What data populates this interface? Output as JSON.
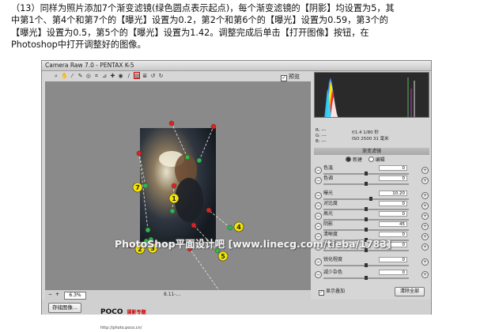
{
  "instructions": {
    "line1": "（13）同样为照片添加7个渐变滤镜(绿色圆点表示起点)，每个渐变滤镜的【阴影】均设置为5，其",
    "line2": "中第1个、第4个和第7个的【曝光】设置为0.2，第2个和第6个的【曝光】设置为0.59，第3个的",
    "line3": "【曝光】设置为0.5，第5个的【曝光】设置为1.42。调整完成后单击【打开图像】按钮，在",
    "line4": "Photoshop中打开调整好的图像。"
  },
  "window": {
    "title": "Camera Raw 7.0 -  PENTAX K-5",
    "preview_label": "预览"
  },
  "toolbar": {
    "tools": [
      {
        "name": "zoom-tool-icon",
        "glyph": "⌕"
      },
      {
        "name": "hand-tool-icon",
        "glyph": "✋"
      },
      {
        "name": "white-balance-tool-icon",
        "glyph": "⁄"
      },
      {
        "name": "color-sampler-tool-icon",
        "glyph": "✎"
      },
      {
        "name": "target-adjustment-tool-icon",
        "glyph": "◎"
      },
      {
        "name": "crop-tool-icon",
        "glyph": "⌗"
      },
      {
        "name": "straighten-tool-icon",
        "glyph": "⊿"
      },
      {
        "name": "spot-removal-tool-icon",
        "glyph": "✚"
      },
      {
        "name": "red-eye-tool-icon",
        "glyph": "◉"
      },
      {
        "name": "adjustment-brush-icon",
        "glyph": "∕"
      },
      {
        "name": "graduated-filter-icon",
        "glyph": "▥"
      },
      {
        "name": "preferences-icon",
        "glyph": "≣"
      },
      {
        "name": "rotate-ccw-icon",
        "glyph": "↺"
      },
      {
        "name": "rotate-cw-icon",
        "glyph": "↻"
      }
    ]
  },
  "markers": [
    "1",
    "2",
    "3",
    "4",
    "5",
    "6",
    "7"
  ],
  "bottom_bar": {
    "zoom_value": "6.3%",
    "status_text": "8.11-..."
  },
  "footer": {
    "save_button": "存储图像...",
    "brand": "POCO",
    "brand_cn": "摄影专题",
    "brand_url": "http://photo.poco.cn/",
    "watermark": "PhotoShop平面设计吧 [www.linecg.com/tieba/1783]"
  },
  "camera_info": {
    "r": "R:  ---",
    "g": "G:  ---",
    "b": "B:  ---",
    "aperture_shutter": "f/1.4   1/80 秒",
    "iso_focal": "ISO 2500   31 毫米"
  },
  "panel": {
    "section_title": "渐变滤镜",
    "mode_new": "新建",
    "mode_edit": "编辑",
    "sliders": [
      {
        "label": "色温",
        "value": "0",
        "pos": 0.5
      },
      {
        "label": "色调",
        "value": "0",
        "pos": 0.5
      },
      {
        "label": "曝光",
        "value": "10.20",
        "pos": 0.56
      },
      {
        "label": "对比度",
        "value": "0",
        "pos": 0.5
      },
      {
        "label": "高光",
        "value": "0",
        "pos": 0.5
      },
      {
        "label": "阴影",
        "value": "45",
        "pos": 0.5
      },
      {
        "label": "清晰度",
        "value": "0",
        "pos": 0.5
      },
      {
        "label": "饱和度",
        "value": "0",
        "pos": 0.5
      },
      {
        "label": "锐化程度",
        "value": "0",
        "pos": 0.5
      },
      {
        "label": "减少杂色",
        "value": "0",
        "pos": 0.5
      }
    ],
    "show_overlay": "显示叠加",
    "clear_all": "清除全部"
  },
  "colors": {
    "marker_yellow": "#f5e400",
    "start_green": "#2db84a",
    "end_red": "#e02020",
    "canvas_gray": "#8a8a8a"
  }
}
